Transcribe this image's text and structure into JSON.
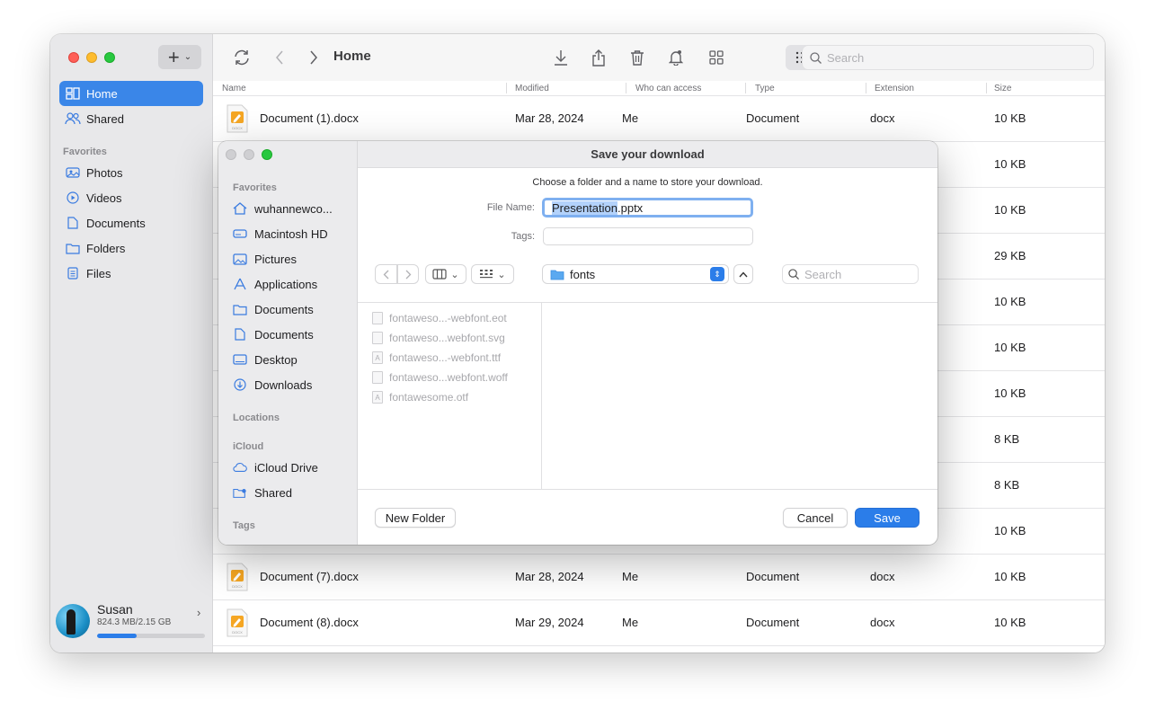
{
  "sidebar": {
    "items": [
      {
        "label": "Home",
        "icon": "home-icon",
        "active": true
      },
      {
        "label": "Shared",
        "icon": "people-icon",
        "active": false
      }
    ],
    "favorites_title": "Favorites",
    "favorites": [
      {
        "label": "Photos",
        "icon": "photos-icon"
      },
      {
        "label": "Videos",
        "icon": "play-icon"
      },
      {
        "label": "Documents",
        "icon": "document-icon"
      },
      {
        "label": "Folders",
        "icon": "folder-icon"
      },
      {
        "label": "Files",
        "icon": "file-icon"
      }
    ],
    "user": {
      "name": "Susan",
      "quota": "824.3 MB/2.15 GB",
      "used_fraction": 0.37
    }
  },
  "toolbar": {
    "title": "Home",
    "search_placeholder": "Search"
  },
  "columns": [
    "Name",
    "Modified",
    "Who can access",
    "Type",
    "Extension",
    "Size"
  ],
  "rows": [
    {
      "name": "Document (1).docx",
      "modified": "Mar 28, 2024",
      "access": "Me",
      "type": "Document",
      "ext": "docx",
      "size": "10 KB"
    },
    {
      "size": "10 KB"
    },
    {
      "size": "10 KB"
    },
    {
      "size": "29 KB"
    },
    {
      "size": "10 KB"
    },
    {
      "size": "10 KB"
    },
    {
      "size": "10 KB"
    },
    {
      "size": "8 KB"
    },
    {
      "size": "8 KB"
    },
    {
      "size": "10 KB"
    },
    {
      "name": "Document (7).docx",
      "modified": "Mar 28, 2024",
      "access": "Me",
      "type": "Document",
      "ext": "docx",
      "size": "10 KB"
    },
    {
      "name": "Document (8).docx",
      "modified": "Mar 29, 2024",
      "access": "Me",
      "type": "Document",
      "ext": "docx",
      "size": "10 KB"
    }
  ],
  "dialog": {
    "title": "Save your download",
    "message": "Choose a folder and a name to store your download.",
    "file_name_label": "File Name:",
    "file_name_selected": "Presentation",
    "file_name_ext": ".pptx",
    "tags_label": "Tags:",
    "location": "fonts",
    "search_placeholder": "Search",
    "favorites_title": "Favorites",
    "favorites": [
      {
        "label": "wuhannewco...",
        "icon": "house-icon"
      },
      {
        "label": "Macintosh HD",
        "icon": "drive-icon"
      },
      {
        "label": "Pictures",
        "icon": "photo-icon"
      },
      {
        "label": "Applications",
        "icon": "apps-icon"
      },
      {
        "label": "Documents",
        "icon": "folder-icon"
      },
      {
        "label": "Documents",
        "icon": "doc-icon"
      },
      {
        "label": "Desktop",
        "icon": "desktop-icon"
      },
      {
        "label": "Downloads",
        "icon": "download-icon"
      }
    ],
    "locations_title": "Locations",
    "icloud_title": "iCloud",
    "icloud": [
      {
        "label": "iCloud Drive",
        "icon": "cloud-icon"
      },
      {
        "label": "Shared",
        "icon": "shared-folder-icon"
      }
    ],
    "tags_title": "Tags",
    "files": [
      "fontaweso...-webfont.eot",
      "fontaweso...webfont.svg",
      "fontaweso...-webfont.ttf",
      "fontaweso...webfont.woff",
      "fontawesome.otf"
    ],
    "new_folder": "New Folder",
    "cancel": "Cancel",
    "save": "Save"
  }
}
